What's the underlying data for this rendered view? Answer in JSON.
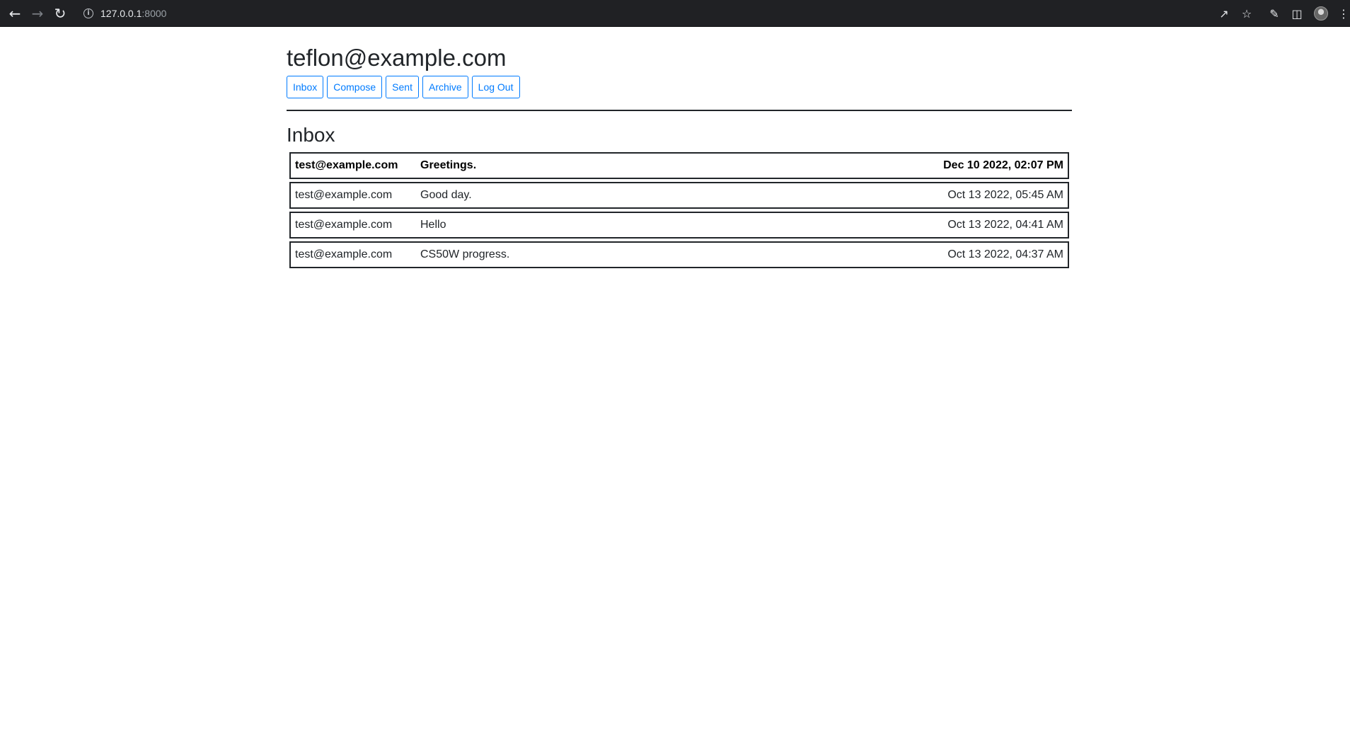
{
  "browser": {
    "url_host": "127.0.0.1",
    "url_port": ":8000",
    "icons": [
      "back-arrow-icon",
      "forward-arrow-icon",
      "reload-icon",
      "site-info-icon",
      "share-icon",
      "star-icon",
      "extensions-icon",
      "side-panel-icon",
      "profile-avatar-icon",
      "menu-icon"
    ]
  },
  "header": {
    "user_email": "teflon@example.com",
    "buttons": {
      "inbox": "Inbox",
      "compose": "Compose",
      "sent": "Sent",
      "archive": "Archive",
      "logout": "Log Out"
    }
  },
  "mailbox": {
    "title": "Inbox",
    "emails": [
      {
        "sender": "test@example.com",
        "subject": "Greetings.",
        "timestamp": "Dec 10 2022, 02:07 PM",
        "read": false
      },
      {
        "sender": "test@example.com",
        "subject": "Good day.",
        "timestamp": "Oct 13 2022, 05:45 AM",
        "read": true
      },
      {
        "sender": "test@example.com",
        "subject": "Hello",
        "timestamp": "Oct 13 2022, 04:41 AM",
        "read": true
      },
      {
        "sender": "test@example.com",
        "subject": "CS50W progress.",
        "timestamp": "Oct 13 2022, 04:37 AM",
        "read": true
      }
    ]
  },
  "colors": {
    "browser_bar": "#202124",
    "button_accent": "#007bff",
    "text": "#212529"
  }
}
